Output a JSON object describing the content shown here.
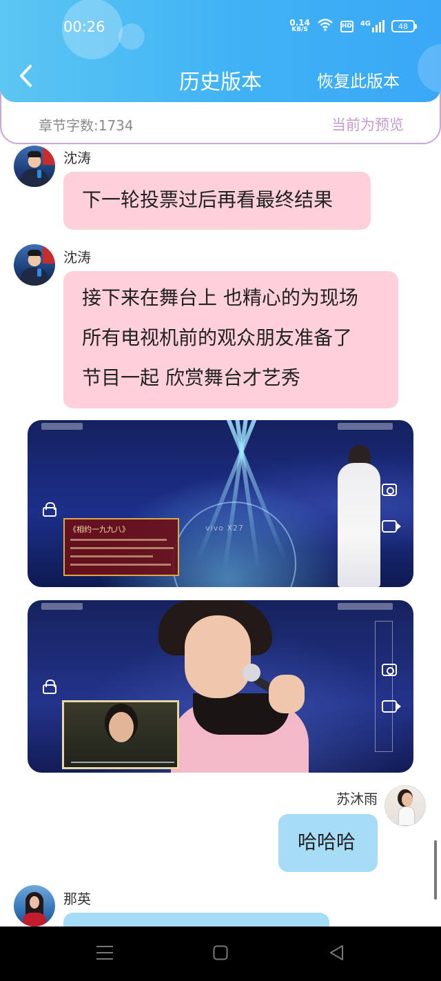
{
  "status_bar": {
    "time": "00:26",
    "net_speed_value": "0.14",
    "net_speed_unit": "KB/S",
    "hd_label": "HD",
    "signal_label": "4G",
    "battery": "48"
  },
  "header": {
    "title": "历史版本",
    "restore_label": "恢复此版本"
  },
  "info_bar": {
    "word_count": "章节字数:1734",
    "preview_label": "当前为预览"
  },
  "messages": [
    {
      "sender": "沈涛",
      "lines": [
        "下一轮投票过后再看最终结果"
      ]
    },
    {
      "sender": "沈涛",
      "lines": [
        "接下来在舞台上 也精心的为现场",
        "所有电视机前的观众朋友准备了",
        "节目一起 欣赏舞台才艺秀"
      ]
    },
    {
      "sender": "苏沐雨",
      "lines": [
        "哈哈哈"
      ]
    },
    {
      "sender": "那英",
      "lines": [
        ""
      ]
    }
  ],
  "media": {
    "video1_logo": "vivo X27",
    "video1_caption": "《相约一九九八》"
  },
  "colors": {
    "header_start": "#5cc6f2",
    "header_end": "#3aa8f6",
    "pink_bubble": "#fed0da",
    "blue_bubble": "#a7dcf6",
    "preview_accent": "#c79ad2"
  }
}
